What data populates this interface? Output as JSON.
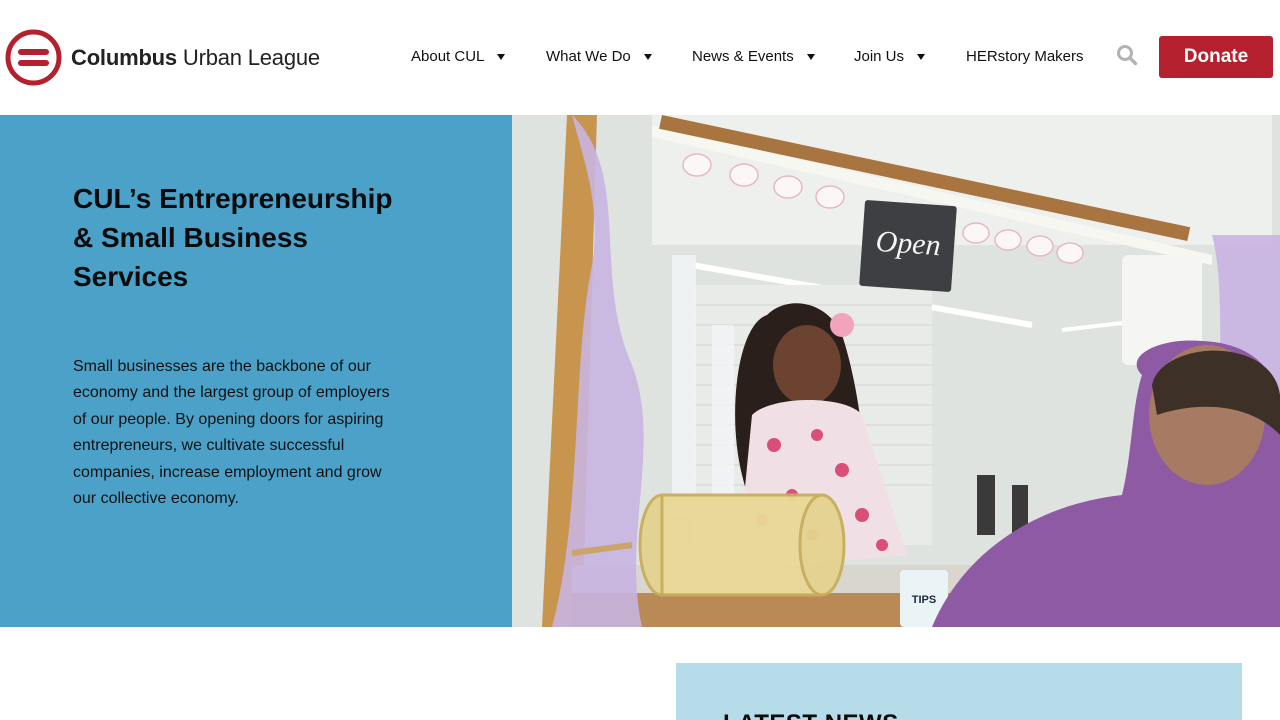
{
  "header": {
    "logo": {
      "name_bold": "Columbus",
      "name_rest": "Urban League",
      "icon": "equality-circle-logo",
      "color": "#b5202e"
    },
    "nav": [
      {
        "label": "About CUL",
        "has_dropdown": true
      },
      {
        "label": "What We Do",
        "has_dropdown": true
      },
      {
        "label": "News & Events",
        "has_dropdown": true
      },
      {
        "label": "Join Us",
        "has_dropdown": true
      },
      {
        "label": "HERstory Makers",
        "has_dropdown": false
      }
    ],
    "search_icon": "search-icon",
    "donate_label": "Donate",
    "donate_color": "#b5202e"
  },
  "hero": {
    "background": "#4ca1c9",
    "title": "CUL’s Entrepreneurship & Small Business Services",
    "body": "Small businesses are the backbone of our economy and the largest group of employers of our people. By opening doors for aspiring entrepreneurs, we cultivate successful companies, increase employment and grow our collective economy.",
    "photo_sign": "Open",
    "photo_tips_sign": "TIPS"
  },
  "news": {
    "title": "LATEST NEWS",
    "background": "#b6dbe9"
  }
}
